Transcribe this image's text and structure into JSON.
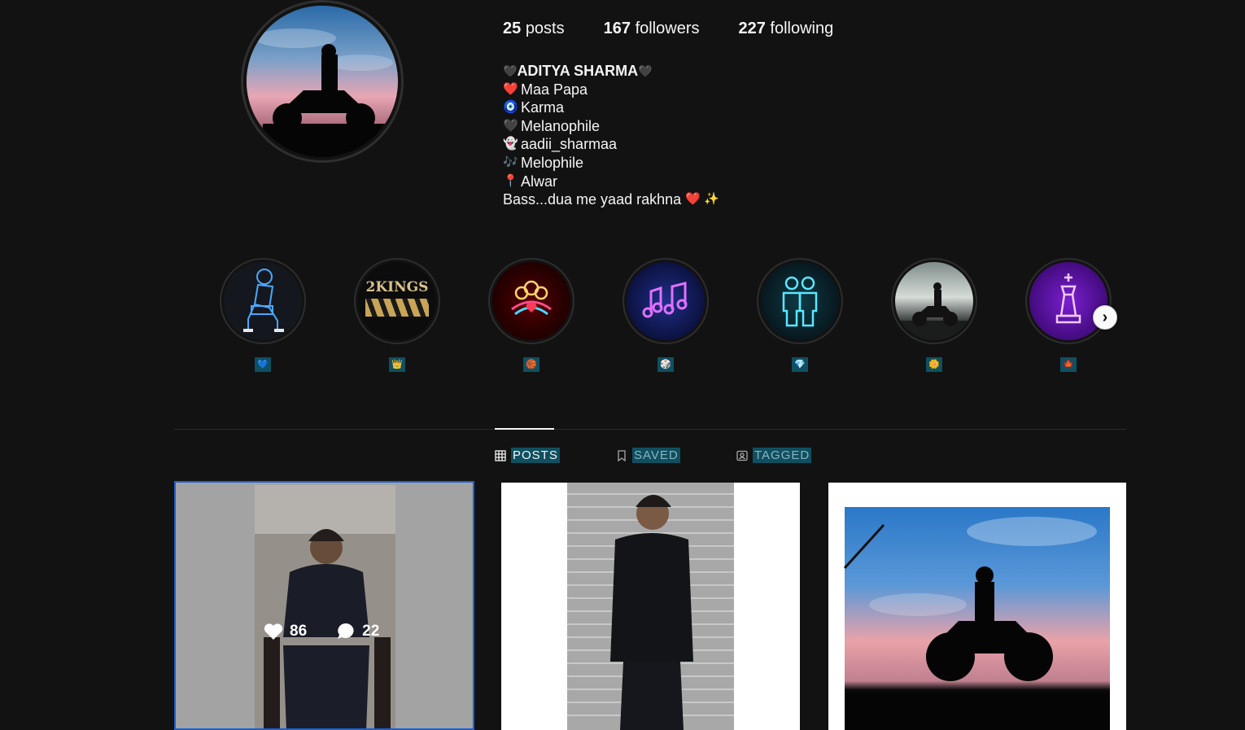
{
  "profile": {
    "stats": [
      {
        "count": "25",
        "label": "posts"
      },
      {
        "count": "167",
        "label": "followers"
      },
      {
        "count": "227",
        "label": "following"
      }
    ],
    "name_left_emoji": "🖤",
    "name": "ADITYA SHARMA",
    "name_right_emoji": "🖤",
    "bio_lines": [
      {
        "emoji": "❤️",
        "text": "Maa Papa"
      },
      {
        "emoji": "🧿",
        "text": "Karma"
      },
      {
        "emoji": "🖤",
        "text": "Melanophile"
      },
      {
        "emoji": "👻",
        "text": "aadii_sharmaa"
      },
      {
        "emoji": "🎶",
        "text": "Melophile"
      },
      {
        "emoji": "📍",
        "text": "Alwar"
      }
    ],
    "bio_last": "Bass...dua me yaad rakhna",
    "bio_last_emojis": "❤️ ✨"
  },
  "highlights": [
    {
      "label": "💙",
      "icon": "sitting-man-neon"
    },
    {
      "label": "👑",
      "icon": "2kings-logo"
    },
    {
      "label": "🏀",
      "icon": "family-heart-neon"
    },
    {
      "label": "🎲",
      "icon": "music-notes-neon"
    },
    {
      "label": "💎",
      "icon": "two-friends-neon"
    },
    {
      "label": "🌼",
      "icon": "bike-silhouette"
    },
    {
      "label": "🍁",
      "icon": "chess-king-neon"
    }
  ],
  "highlight_brand_text": "2KINGS",
  "tabs": [
    {
      "label": "POSTS",
      "icon": "grid-icon",
      "active": true
    },
    {
      "label": "SAVED",
      "icon": "bookmark-icon",
      "active": false
    },
    {
      "label": "TAGGED",
      "icon": "tag-person-icon",
      "active": false
    }
  ],
  "posts": [
    {
      "likes": "86",
      "comments": "22"
    }
  ],
  "colors": {
    "background": "#121212",
    "label_bg": "#0f4f60",
    "selected_border": "#1d5fcf"
  }
}
